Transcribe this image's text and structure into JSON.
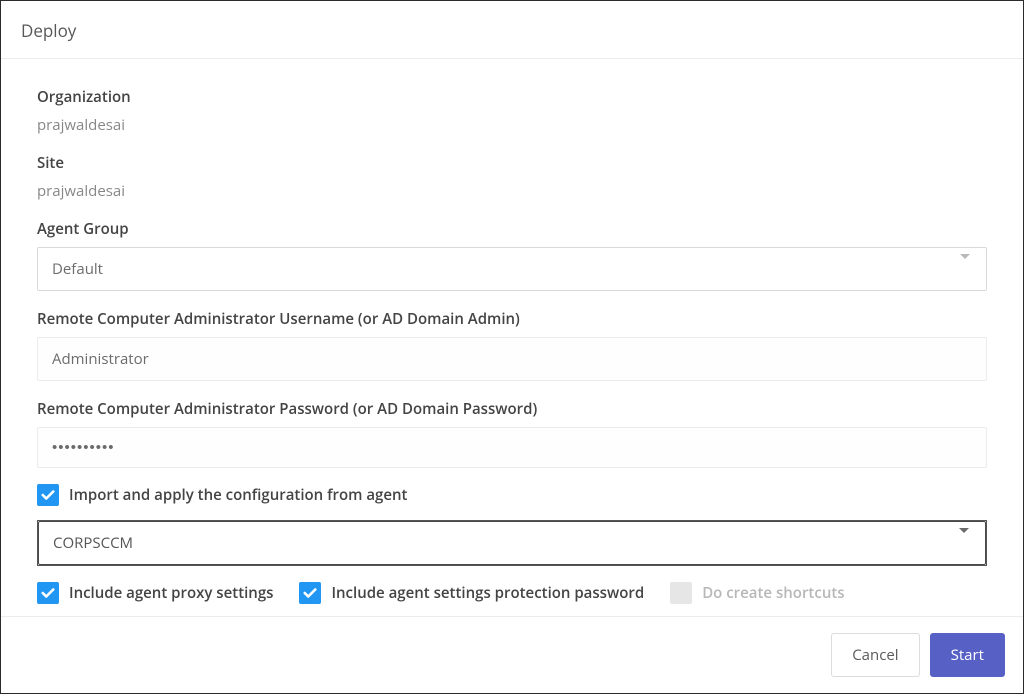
{
  "title": "Deploy",
  "organization": {
    "label": "Organization",
    "value": "prajwaldesai"
  },
  "site": {
    "label": "Site",
    "value": "prajwaldesai"
  },
  "agent_group": {
    "label": "Agent Group",
    "selected": "Default"
  },
  "username": {
    "label": "Remote Computer Administrator Username (or AD Domain Admin)",
    "value": "Administrator"
  },
  "password": {
    "label": "Remote Computer Administrator Password (or AD Domain Password)",
    "masked_value": "••••••••••"
  },
  "import_config": {
    "label": "Import and apply the configuration from agent",
    "checked": true,
    "selected": "CORPSCCM"
  },
  "options": {
    "include_proxy": {
      "label": "Include agent proxy settings",
      "checked": true
    },
    "include_protection": {
      "label": "Include agent settings protection password",
      "checked": true
    },
    "create_shortcuts": {
      "label": "Do create shortcuts",
      "checked": false,
      "disabled": true
    }
  },
  "buttons": {
    "cancel": "Cancel",
    "start": "Start"
  }
}
